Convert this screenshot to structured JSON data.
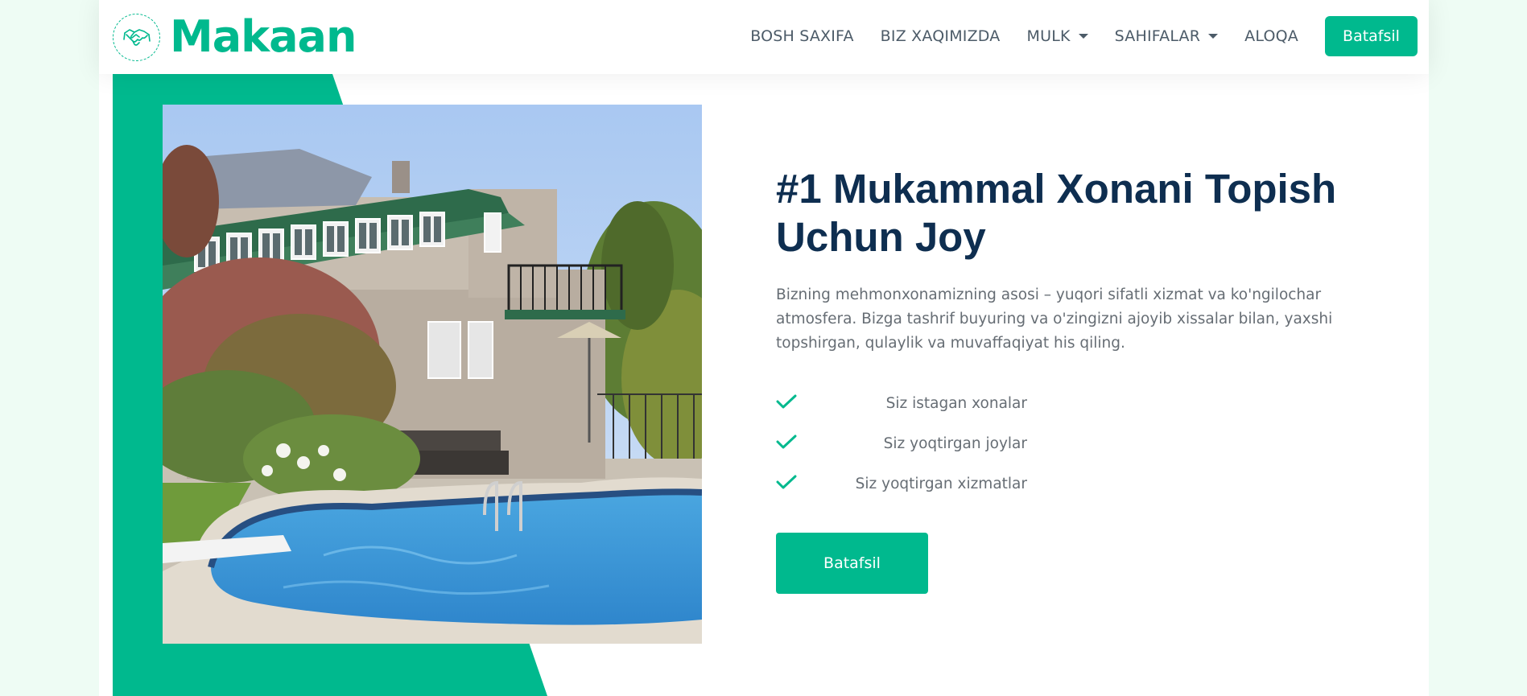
{
  "brand": {
    "name": "Makaan",
    "logo_icon": "handshake-icon"
  },
  "nav": {
    "items": [
      {
        "label": "BOSH SAXIFA",
        "dropdown": false
      },
      {
        "label": "BIZ XAQIMIZDA",
        "dropdown": false
      },
      {
        "label": "MULK",
        "dropdown": true
      },
      {
        "label": "SAHIFALAR",
        "dropdown": true
      },
      {
        "label": "ALOQA",
        "dropdown": false
      }
    ],
    "button_label": "Batafsil"
  },
  "hero": {
    "title": "#1 Mukammal Xonani Topish Uchun Joy",
    "description": "Bizning mehmonxonamizning asosi – yuqori sifatli xizmat va ko'ngilochar atmosfera. Bizga tashrif buyuring va o'zingizni ajoyib xissalar bilan, yaxshi topshirgan, qulaylik va muvaffaqiyat his qiling.",
    "checklist": [
      "Siz istagan xonalar",
      "Siz yoqtirgan joylar",
      "Siz yoqtirgan xizmatlar"
    ],
    "button_label": "Batafsil",
    "image_icon": "house-with-pool-image"
  },
  "colors": {
    "primary": "#00b98e",
    "heading": "#0e2e50",
    "text": "#666d74",
    "background": "#eefcf4"
  }
}
